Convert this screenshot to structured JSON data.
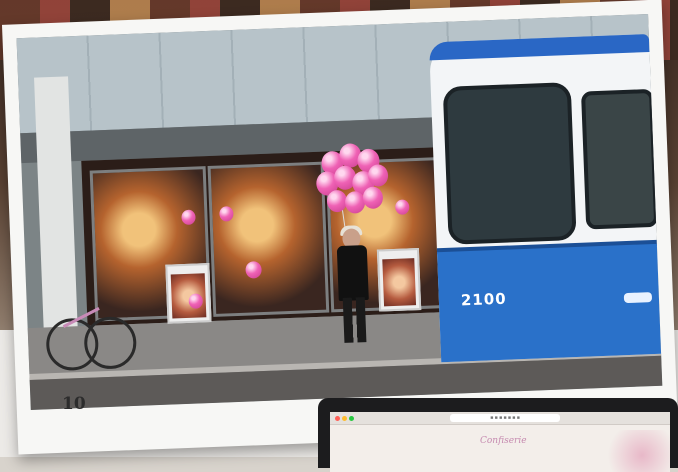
{
  "scene": {
    "tram_number": "2100",
    "page_number": "10"
  },
  "laptop": {
    "url_text": "■ ■ ■ ■ ■ ■ ■",
    "logo_text": "Confiserie"
  },
  "colors": {
    "tram_blue": "#2a71c9",
    "balloon_pink": "#ef62b5",
    "print_white": "#f7f7f5"
  }
}
